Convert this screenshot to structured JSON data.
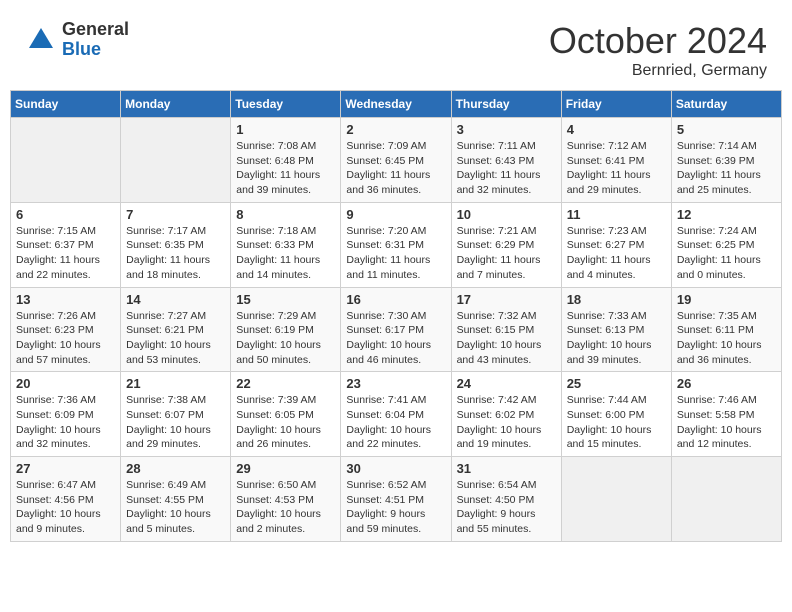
{
  "header": {
    "logo_general": "General",
    "logo_blue": "Blue",
    "month_title": "October 2024",
    "subtitle": "Bernried, Germany"
  },
  "weekdays": [
    "Sunday",
    "Monday",
    "Tuesday",
    "Wednesday",
    "Thursday",
    "Friday",
    "Saturday"
  ],
  "weeks": [
    [
      {
        "day": "",
        "info": ""
      },
      {
        "day": "",
        "info": ""
      },
      {
        "day": "1",
        "info": "Sunrise: 7:08 AM\nSunset: 6:48 PM\nDaylight: 11 hours and 39 minutes."
      },
      {
        "day": "2",
        "info": "Sunrise: 7:09 AM\nSunset: 6:45 PM\nDaylight: 11 hours and 36 minutes."
      },
      {
        "day": "3",
        "info": "Sunrise: 7:11 AM\nSunset: 6:43 PM\nDaylight: 11 hours and 32 minutes."
      },
      {
        "day": "4",
        "info": "Sunrise: 7:12 AM\nSunset: 6:41 PM\nDaylight: 11 hours and 29 minutes."
      },
      {
        "day": "5",
        "info": "Sunrise: 7:14 AM\nSunset: 6:39 PM\nDaylight: 11 hours and 25 minutes."
      }
    ],
    [
      {
        "day": "6",
        "info": "Sunrise: 7:15 AM\nSunset: 6:37 PM\nDaylight: 11 hours and 22 minutes."
      },
      {
        "day": "7",
        "info": "Sunrise: 7:17 AM\nSunset: 6:35 PM\nDaylight: 11 hours and 18 minutes."
      },
      {
        "day": "8",
        "info": "Sunrise: 7:18 AM\nSunset: 6:33 PM\nDaylight: 11 hours and 14 minutes."
      },
      {
        "day": "9",
        "info": "Sunrise: 7:20 AM\nSunset: 6:31 PM\nDaylight: 11 hours and 11 minutes."
      },
      {
        "day": "10",
        "info": "Sunrise: 7:21 AM\nSunset: 6:29 PM\nDaylight: 11 hours and 7 minutes."
      },
      {
        "day": "11",
        "info": "Sunrise: 7:23 AM\nSunset: 6:27 PM\nDaylight: 11 hours and 4 minutes."
      },
      {
        "day": "12",
        "info": "Sunrise: 7:24 AM\nSunset: 6:25 PM\nDaylight: 11 hours and 0 minutes."
      }
    ],
    [
      {
        "day": "13",
        "info": "Sunrise: 7:26 AM\nSunset: 6:23 PM\nDaylight: 10 hours and 57 minutes."
      },
      {
        "day": "14",
        "info": "Sunrise: 7:27 AM\nSunset: 6:21 PM\nDaylight: 10 hours and 53 minutes."
      },
      {
        "day": "15",
        "info": "Sunrise: 7:29 AM\nSunset: 6:19 PM\nDaylight: 10 hours and 50 minutes."
      },
      {
        "day": "16",
        "info": "Sunrise: 7:30 AM\nSunset: 6:17 PM\nDaylight: 10 hours and 46 minutes."
      },
      {
        "day": "17",
        "info": "Sunrise: 7:32 AM\nSunset: 6:15 PM\nDaylight: 10 hours and 43 minutes."
      },
      {
        "day": "18",
        "info": "Sunrise: 7:33 AM\nSunset: 6:13 PM\nDaylight: 10 hours and 39 minutes."
      },
      {
        "day": "19",
        "info": "Sunrise: 7:35 AM\nSunset: 6:11 PM\nDaylight: 10 hours and 36 minutes."
      }
    ],
    [
      {
        "day": "20",
        "info": "Sunrise: 7:36 AM\nSunset: 6:09 PM\nDaylight: 10 hours and 32 minutes."
      },
      {
        "day": "21",
        "info": "Sunrise: 7:38 AM\nSunset: 6:07 PM\nDaylight: 10 hours and 29 minutes."
      },
      {
        "day": "22",
        "info": "Sunrise: 7:39 AM\nSunset: 6:05 PM\nDaylight: 10 hours and 26 minutes."
      },
      {
        "day": "23",
        "info": "Sunrise: 7:41 AM\nSunset: 6:04 PM\nDaylight: 10 hours and 22 minutes."
      },
      {
        "day": "24",
        "info": "Sunrise: 7:42 AM\nSunset: 6:02 PM\nDaylight: 10 hours and 19 minutes."
      },
      {
        "day": "25",
        "info": "Sunrise: 7:44 AM\nSunset: 6:00 PM\nDaylight: 10 hours and 15 minutes."
      },
      {
        "day": "26",
        "info": "Sunrise: 7:46 AM\nSunset: 5:58 PM\nDaylight: 10 hours and 12 minutes."
      }
    ],
    [
      {
        "day": "27",
        "info": "Sunrise: 6:47 AM\nSunset: 4:56 PM\nDaylight: 10 hours and 9 minutes."
      },
      {
        "day": "28",
        "info": "Sunrise: 6:49 AM\nSunset: 4:55 PM\nDaylight: 10 hours and 5 minutes."
      },
      {
        "day": "29",
        "info": "Sunrise: 6:50 AM\nSunset: 4:53 PM\nDaylight: 10 hours and 2 minutes."
      },
      {
        "day": "30",
        "info": "Sunrise: 6:52 AM\nSunset: 4:51 PM\nDaylight: 9 hours and 59 minutes."
      },
      {
        "day": "31",
        "info": "Sunrise: 6:54 AM\nSunset: 4:50 PM\nDaylight: 9 hours and 55 minutes."
      },
      {
        "day": "",
        "info": ""
      },
      {
        "day": "",
        "info": ""
      }
    ]
  ]
}
